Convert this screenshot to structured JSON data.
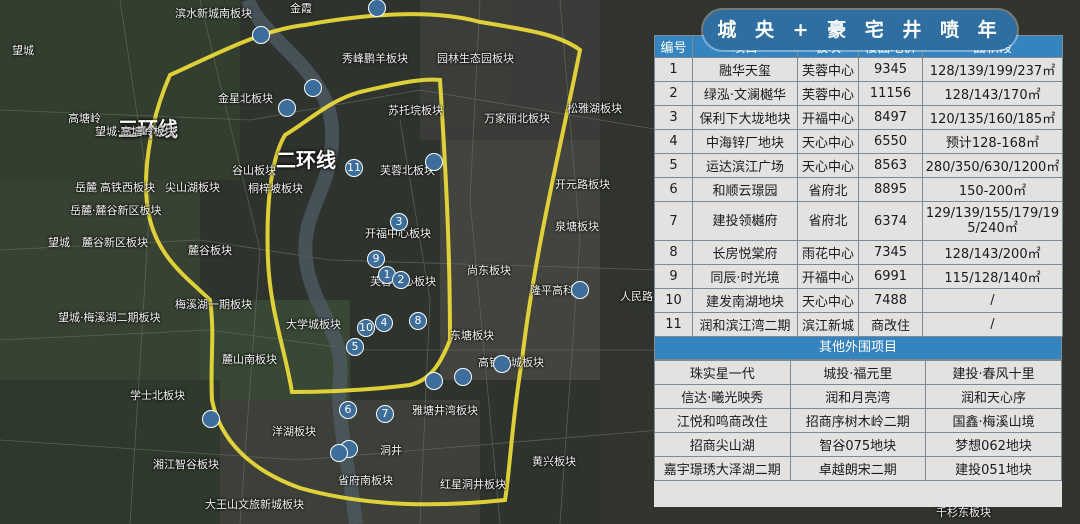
{
  "title": "城 央 + 豪 宅 井 喷 年",
  "ring_labels": {
    "third": "三环线",
    "second": "二环线"
  },
  "district_labels": [
    "滨水新城南板块",
    "金霞",
    "金星北板块",
    "秀峰鹏羊板块",
    "园林生态园板块",
    "望城",
    "高塘岭",
    "望城·高塘岭板块",
    "苏托垸板块",
    "万家丽北板块",
    "松雅湖板块",
    "谷山板块",
    "岳麓",
    "高铁西板块",
    "尖山湖板块",
    "芙蓉北板块",
    "岳麓·麓谷新区板块",
    "开元路板块",
    "桐梓坡板块",
    "开福中心板块",
    "泉塘板块",
    "望城",
    "麓谷新区板块",
    "麓谷板块",
    "芙蓉中心板块",
    "尚东板块",
    "隆平高科",
    "人民路",
    "梅溪湖一期板块",
    "望城·梅溪湖二期板块",
    "大学城板块",
    "东塘板块",
    "麓山南板块",
    "高铁新城板块",
    "学士北板块",
    "洋湖板块",
    "雅塘井湾板块",
    "湘江智谷板块",
    "省府南板块",
    "黄兴板块",
    "红星洞井板块",
    "大王山文旅新城板块",
    "洞井",
    "千杉东板块"
  ],
  "project_table": {
    "headers": [
      "编号",
      "项目",
      "板块",
      "楼面地价",
      "面积段"
    ],
    "rows": [
      [
        "1",
        "融华天玺",
        "芙蓉中心",
        "9345",
        "128/139/199/237㎡"
      ],
      [
        "2",
        "绿泓·文澜樾华",
        "芙蓉中心",
        "11156",
        "128/143/170㎡"
      ],
      [
        "3",
        "保利下大垅地块",
        "开福中心",
        "8497",
        "120/135/160/185㎡"
      ],
      [
        "4",
        "中海锌厂地块",
        "天心中心",
        "6550",
        "预计128-168㎡"
      ],
      [
        "5",
        "运达滨江广场",
        "天心中心",
        "8563",
        "280/350/630/1200㎡"
      ],
      [
        "6",
        "和顺云璟园",
        "省府北",
        "8895",
        "150-200㎡"
      ],
      [
        "7",
        "建投领樾府",
        "省府北",
        "6374",
        "129/139/155/179/195/240㎡"
      ],
      [
        "8",
        "长房悦棠府",
        "雨花中心",
        "7345",
        "128/143/200㎡"
      ],
      [
        "9",
        "同辰·时光境",
        "开福中心",
        "6991",
        "115/128/140㎡"
      ],
      [
        "10",
        "建发南湖地块",
        "天心中心",
        "7488",
        "/"
      ],
      [
        "11",
        "润和滨江湾二期",
        "滨江新城",
        "商改住",
        "/"
      ]
    ]
  },
  "other_section": {
    "title": "其他外围项目",
    "rows": [
      [
        "珠实星一代",
        "城投·福元里",
        "建投·春风十里"
      ],
      [
        "信达·曦光映秀",
        "润和月亮湾",
        "润和天心序"
      ],
      [
        "江悦和鸣商改住",
        "招商序树木岭二期",
        "国鑫·梅溪山境"
      ],
      [
        "招商尖山湖",
        "智谷075地块",
        "梦想062地块"
      ],
      [
        "嘉宇璟琇大泽湖二期",
        "卓越朗宋二期",
        "建投051地块"
      ]
    ]
  },
  "map_markers": [
    "1",
    "2",
    "3",
    "4",
    "5",
    "6",
    "7",
    "8",
    "9",
    "10",
    "11"
  ],
  "colors": {
    "ring": "#f2e03a",
    "marker": "#3d6d9a",
    "header": "#3584bf",
    "title_pill": "#2e6ea1"
  }
}
